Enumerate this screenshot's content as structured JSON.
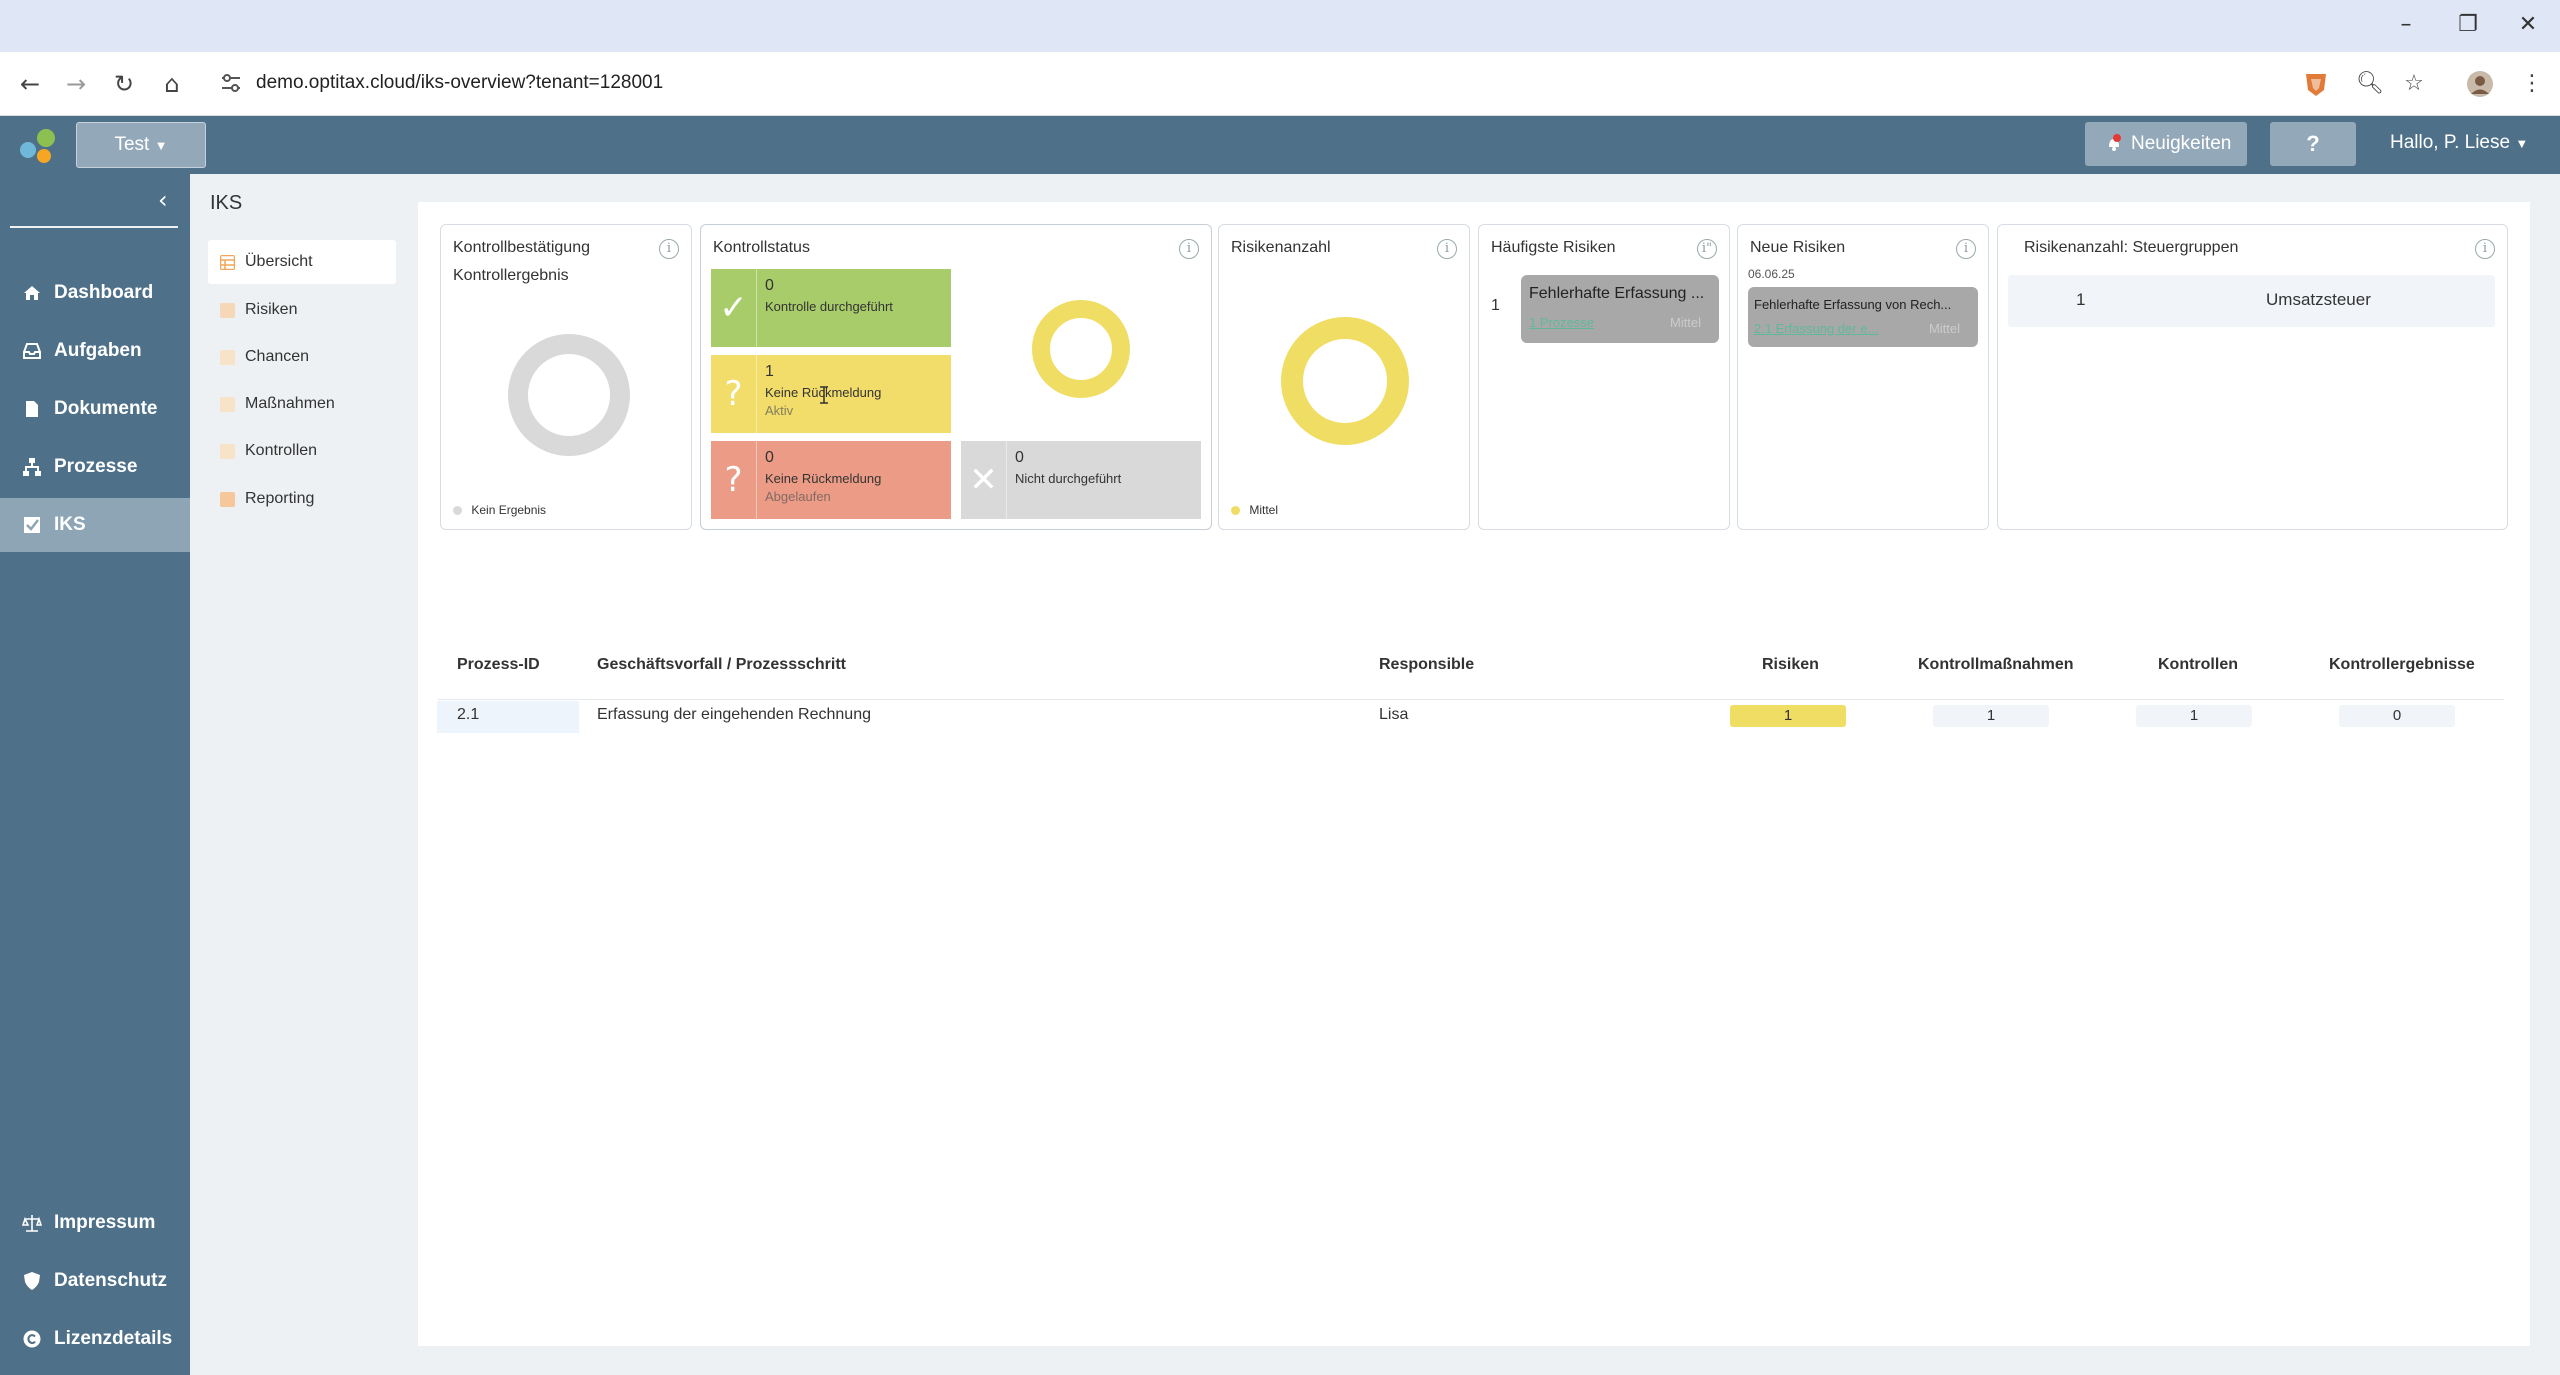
{
  "browser": {
    "url": "demo.optitax.cloud/iks-overview?tenant=128001",
    "minimize": "–",
    "restore": "❐",
    "close": "✕"
  },
  "header": {
    "tenant_label": "Test",
    "news_label": "Neuigkeiten",
    "help_label": "?",
    "user_label": "Hallo, P. Liese"
  },
  "sidebar": {
    "items": [
      {
        "label": "Dashboard",
        "icon": "home-icon"
      },
      {
        "label": "Aufgaben",
        "icon": "inbox-icon"
      },
      {
        "label": "Dokumente",
        "icon": "document-icon"
      },
      {
        "label": "Prozesse",
        "icon": "sitemap-icon"
      },
      {
        "label": "IKS",
        "icon": "check-square-icon"
      }
    ],
    "footer_items": [
      {
        "label": "Impressum",
        "icon": "scale-icon"
      },
      {
        "label": "Datenschutz",
        "icon": "shield-icon"
      },
      {
        "label": "Lizenzdetails",
        "icon": "copyright-icon"
      }
    ]
  },
  "page": {
    "title": "IKS"
  },
  "subnav": {
    "items": [
      {
        "label": "Übersicht"
      },
      {
        "label": "Risiken"
      },
      {
        "label": "Chancen"
      },
      {
        "label": "Maßnahmen"
      },
      {
        "label": "Kontrollen"
      },
      {
        "label": "Reporting"
      }
    ]
  },
  "cards": {
    "kontrollbestaetigung": {
      "title": "Kontrollbestätigung",
      "subtitle": "Kontrollergebnis",
      "legend": "Kein Ergebnis",
      "color": "#d9d9d9"
    },
    "kontrollstatus": {
      "title": "Kontrollstatus",
      "tiles": [
        {
          "count": "0",
          "label": "Kontrolle durchgeführt",
          "sub": "",
          "icon": "✓",
          "color": "#a9cc6a"
        },
        {
          "count": "1",
          "label": "Keine Rückmeldung",
          "sub": "Aktiv",
          "icon": "?",
          "color": "#f2dd6b"
        },
        {
          "count": "0",
          "label": "Keine Rückmeldung",
          "sub": "Abgelaufen",
          "icon": "?",
          "color": "#ec9c86"
        },
        {
          "count": "0",
          "label": "Nicht durchgeführt",
          "sub": "",
          "icon": "✕",
          "color": "#d9d9d9"
        }
      ]
    },
    "risikenanzahl": {
      "title": "Risikenanzahl",
      "legend": "Mittel",
      "color": "#f0dd64"
    },
    "haeufigste": {
      "title": "Häufigste Risiken",
      "rank": "1",
      "risk_title": "Fehlerhafte Erfassung ...",
      "link": "1 Prozesse",
      "level": "Mittel"
    },
    "neue": {
      "title": "Neue Risiken",
      "date": "06.06.25",
      "risk_title": "Fehlerhafte Erfassung von Rech...",
      "link": "2.1 Erfassung der e...",
      "level": "Mittel"
    },
    "steuergruppen": {
      "title": "Risikenanzahl: Steuergruppen",
      "count": "1",
      "group": "Umsatzsteuer"
    }
  },
  "table": {
    "headers": {
      "id": "Prozess-ID",
      "name": "Geschäftsvorfall / Prozessschritt",
      "responsible": "Responsible",
      "risks": "Risiken",
      "measures": "Kontrollmaßnahmen",
      "controls": "Kontrollen",
      "results": "Kontrollergebnisse"
    },
    "rows": [
      {
        "id": "2.1",
        "name": "Erfassung der eingehenden Rechnung",
        "responsible": "Lisa",
        "risks": "1",
        "measures": "1",
        "controls": "1",
        "results": "0"
      }
    ]
  },
  "colors": {
    "header_bg": "#4e7089",
    "accent_yellow": "#f0dd64",
    "accent_green": "#a9cc6a",
    "accent_red": "#ec9c86",
    "neutral_gray": "#d9d9d9"
  }
}
